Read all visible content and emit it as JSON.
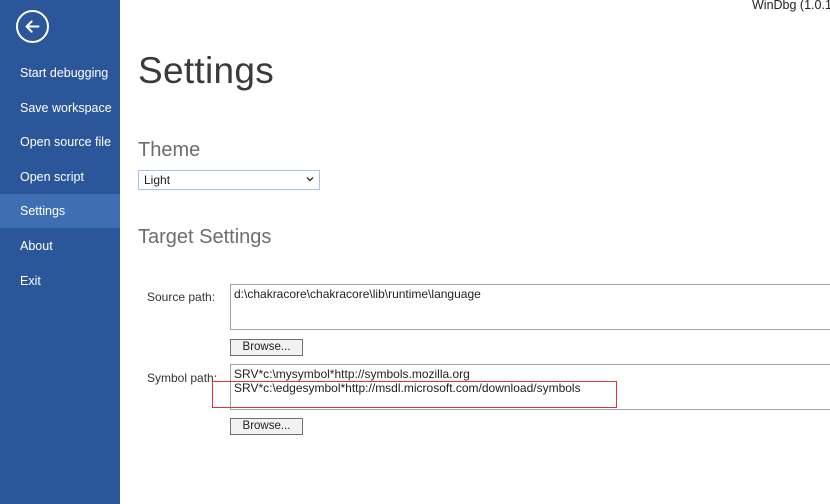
{
  "window": {
    "app_title": "WinDbg (1.0.1"
  },
  "sidebar": {
    "items": [
      {
        "label": "Start debugging",
        "active": false
      },
      {
        "label": "Save workspace",
        "active": false
      },
      {
        "label": "Open source file",
        "active": false
      },
      {
        "label": "Open script",
        "active": false
      },
      {
        "label": "Settings",
        "active": true
      },
      {
        "label": "About",
        "active": false
      },
      {
        "label": "Exit",
        "active": false
      }
    ],
    "back_icon": "back-arrow-icon"
  },
  "main": {
    "title": "Settings",
    "theme": {
      "heading": "Theme",
      "selected": "Light"
    },
    "target": {
      "heading": "Target Settings",
      "source_path": {
        "label": "Source path:",
        "value": "d:\\chakracore\\chakracore\\lib\\runtime\\language",
        "browse_label": "Browse..."
      },
      "symbol_path": {
        "label": "Symbol path:",
        "lines": [
          "SRV*c:\\mysymbol*http://symbols.mozilla.org",
          "SRV*c:\\edgesymbol*http://msdl.microsoft.com/download/symbols"
        ],
        "browse_label": "Browse..."
      }
    }
  },
  "colors": {
    "sidebar": "#2b579a",
    "sidebar_active": "#3f6fb3",
    "highlight": "#e2353b"
  }
}
